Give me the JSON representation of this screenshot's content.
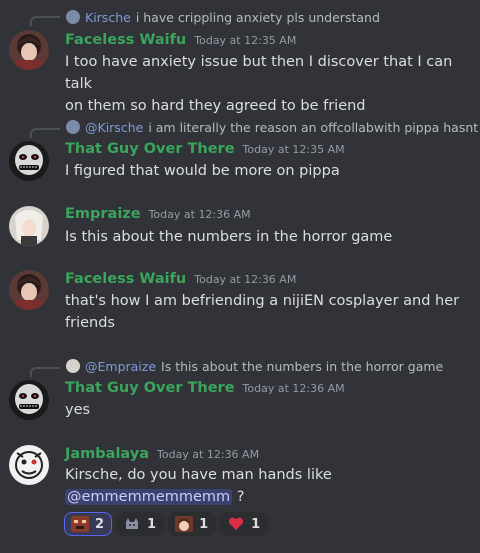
{
  "colors": {
    "background": "#313338",
    "username_green": "#3ba55c",
    "mention_bg": "#3c4270",
    "reply_name_blue": "#7f9bd6"
  },
  "messages": [
    {
      "reply": {
        "name": "Kirsche",
        "text": "i have crippling anxiety pls understand"
      },
      "author": "Faceless Waifu",
      "time": "Today at 12:35 AM",
      "lines": [
        "I too have anxiety issue but then I discover that I can talk",
        "on them so hard they agreed to be friend"
      ]
    },
    {
      "reply": {
        "name": "@Kirsche",
        "text": "i am literally the reason an offcollabwith pippa hasnt h"
      },
      "author": "That Guy Over There",
      "time": "Today at 12:35 AM",
      "lines": [
        "I figured that would be more on pippa"
      ]
    },
    {
      "author": "Empraize",
      "time": "Today at 12:36 AM",
      "lines": [
        "Is this about the numbers in the horror game"
      ]
    },
    {
      "author": "Faceless Waifu",
      "time": "Today at 12:36 AM",
      "lines": [
        "that's how I am befriending a nijiEN cosplayer and her",
        "friends"
      ]
    },
    {
      "reply": {
        "name": "@Empraize",
        "text": "Is this about the numbers in the horror game"
      },
      "author": "That Guy Over There",
      "time": "Today at 12:36 AM",
      "lines": [
        "yes"
      ]
    },
    {
      "author": "Jambalaya",
      "time": "Today at 12:36 AM",
      "lines": [
        "Kirsche, do you have man hands like"
      ],
      "mention": "@emmemmemmemm",
      "after_mention": " ?"
    }
  ],
  "reactions": [
    {
      "emoji": "pixel-face-emoji",
      "count": "2",
      "active": true
    },
    {
      "emoji": "cat-icon-emoji",
      "count": "1",
      "active": false
    },
    {
      "emoji": "anime-face-emoji",
      "count": "1",
      "active": false
    },
    {
      "emoji": "heart-emoji",
      "count": "1",
      "active": false
    }
  ]
}
